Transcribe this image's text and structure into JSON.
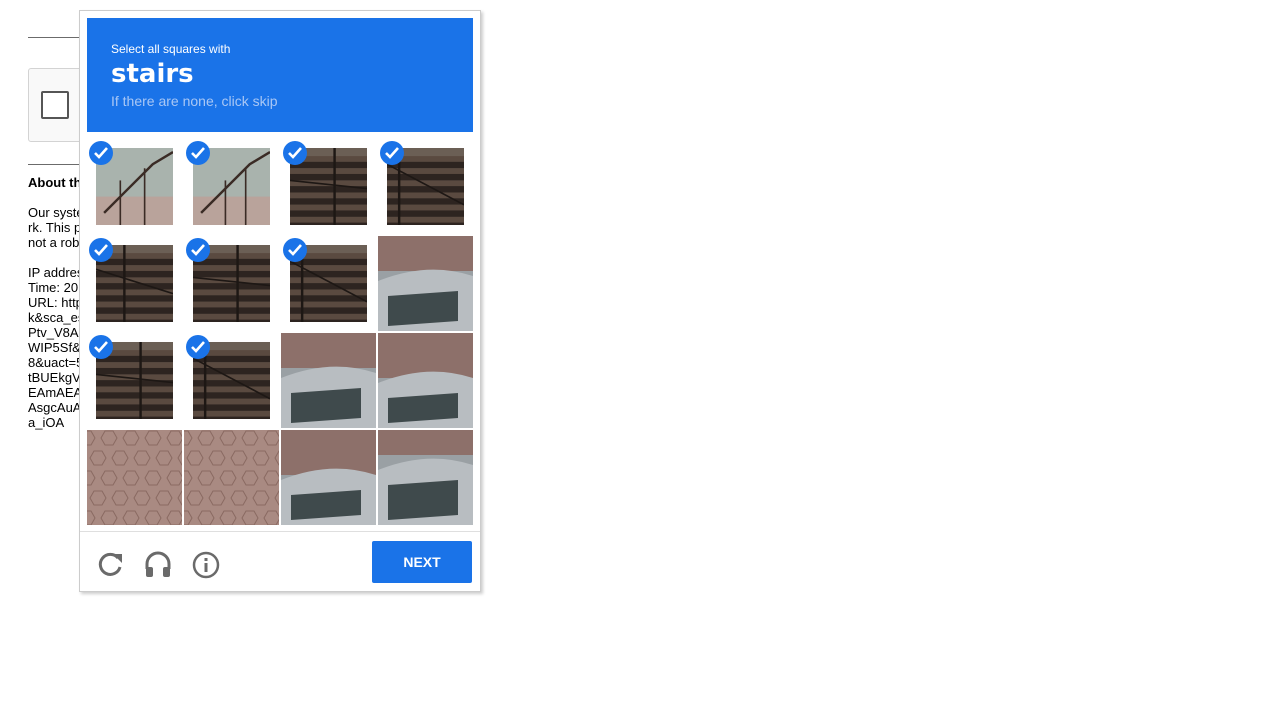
{
  "background": {
    "heading": "About th",
    "paragraph_lines": [
      "Our syste",
      "rk. This p",
      "not a rob"
    ],
    "info_lines": [
      "IP addres",
      "Time: 20",
      "URL: http",
      "k&sca_es",
      "Ptv_V8A",
      "WIP5Sf&",
      "8&uact=5",
      "tBUEkgV",
      "EAmAEA",
      "AsgcAuA",
      "a_iOA"
    ]
  },
  "captcha": {
    "instruction": "Select all squares with",
    "target": "stairs",
    "hint": "If there are none, click skip",
    "tiles": [
      {
        "row": 0,
        "col": 0,
        "content": "stair railing",
        "selected": true
      },
      {
        "row": 0,
        "col": 1,
        "content": "stair railing",
        "selected": true
      },
      {
        "row": 0,
        "col": 2,
        "content": "stairs",
        "selected": true
      },
      {
        "row": 0,
        "col": 3,
        "content": "stairs",
        "selected": true
      },
      {
        "row": 1,
        "col": 0,
        "content": "stairs",
        "selected": true
      },
      {
        "row": 1,
        "col": 1,
        "content": "stairs",
        "selected": true
      },
      {
        "row": 1,
        "col": 2,
        "content": "stairs",
        "selected": true
      },
      {
        "row": 1,
        "col": 3,
        "content": "car",
        "selected": false
      },
      {
        "row": 2,
        "col": 0,
        "content": "stairs",
        "selected": true
      },
      {
        "row": 2,
        "col": 1,
        "content": "stairs",
        "selected": true
      },
      {
        "row": 2,
        "col": 2,
        "content": "car",
        "selected": false
      },
      {
        "row": 2,
        "col": 3,
        "content": "car",
        "selected": false
      },
      {
        "row": 3,
        "col": 0,
        "content": "pavement",
        "selected": false
      },
      {
        "row": 3,
        "col": 1,
        "content": "pavement",
        "selected": false
      },
      {
        "row": 3,
        "col": 2,
        "content": "car",
        "selected": false
      },
      {
        "row": 3,
        "col": 3,
        "content": "car",
        "selected": false
      }
    ],
    "footer": {
      "reload_icon": "reload-icon",
      "audio_icon": "headphones-icon",
      "info_icon": "info-icon",
      "next_label": "Next"
    },
    "colors": {
      "accent": "#1a73e8",
      "hint": "#a9c7f5"
    }
  }
}
